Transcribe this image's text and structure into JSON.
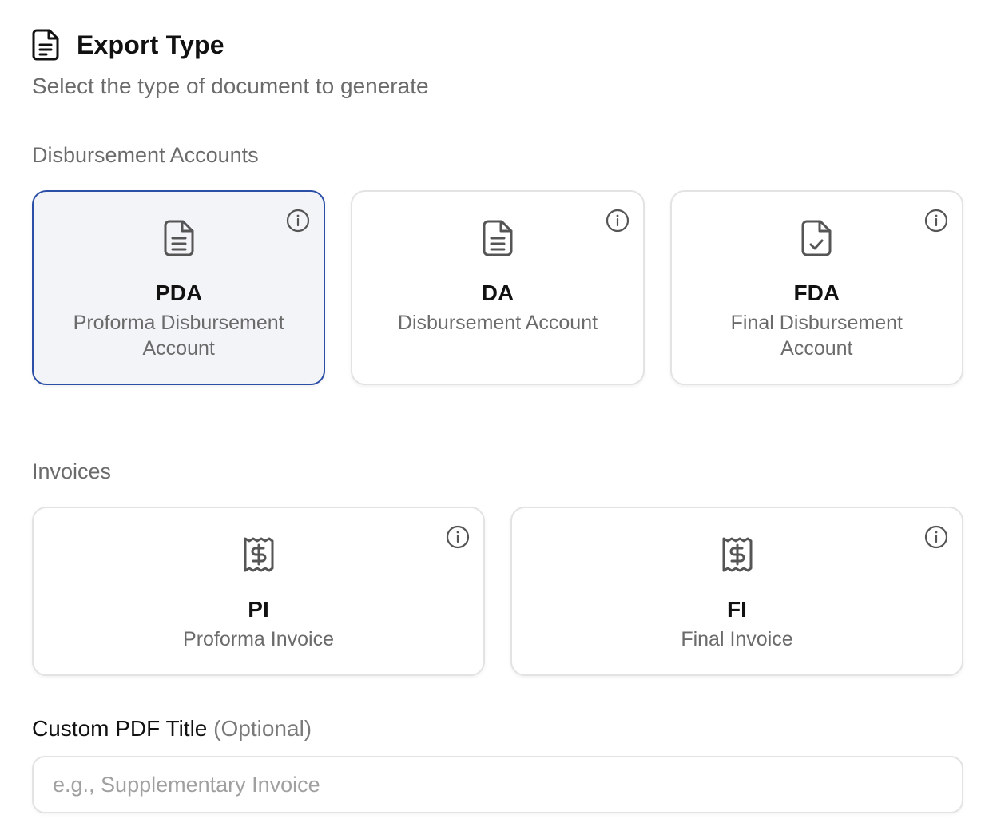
{
  "header": {
    "title": "Export Type",
    "subtitle": "Select the type of document to generate",
    "icon": "document-icon"
  },
  "colors": {
    "selected_border": "#2b4fa6",
    "selected_background": "#f2f4f8",
    "muted_text": "#6b6b6b"
  },
  "disbursement": {
    "label": "Disbursement Accounts",
    "cards": [
      {
        "code": "PDA",
        "description": "Proforma Disbursement Account",
        "icon": "document-lines-icon",
        "selected": true
      },
      {
        "code": "DA",
        "description": "Disbursement Account",
        "icon": "document-lines-icon",
        "selected": false
      },
      {
        "code": "FDA",
        "description": "Final Disbursement Account",
        "icon": "document-check-icon",
        "selected": false
      }
    ]
  },
  "invoices": {
    "label": "Invoices",
    "cards": [
      {
        "code": "PI",
        "description": "Proforma Invoice",
        "icon": "receipt-dollar-icon",
        "selected": false
      },
      {
        "code": "FI",
        "description": "Final Invoice",
        "icon": "receipt-dollar-icon",
        "selected": false
      }
    ]
  },
  "custom_title": {
    "label": "Custom PDF Title",
    "optional": "(Optional)",
    "placeholder": "e.g., Supplementary Invoice",
    "value": ""
  }
}
